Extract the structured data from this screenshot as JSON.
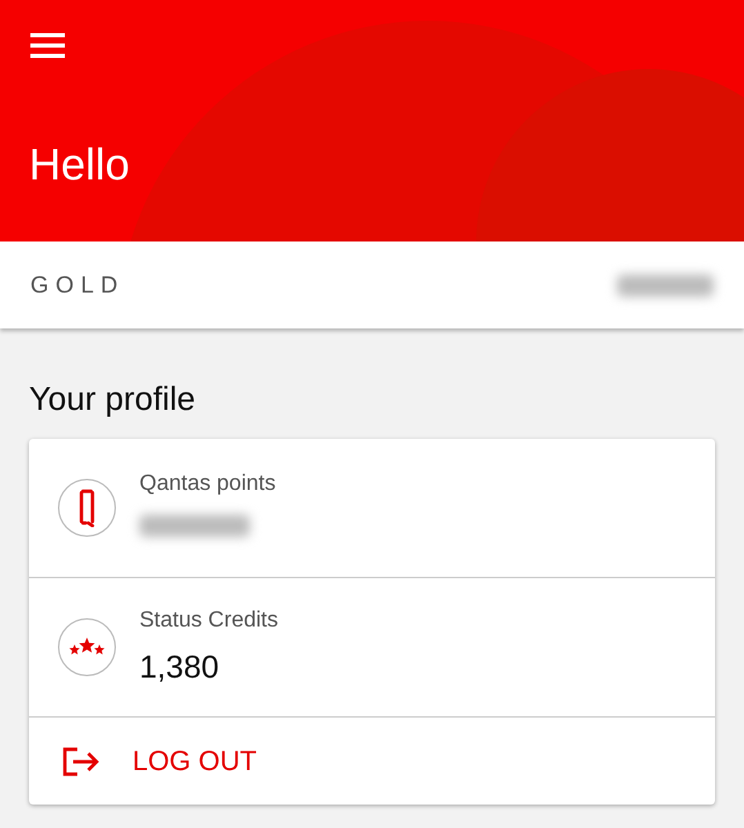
{
  "header": {
    "greeting": "Hello"
  },
  "membership": {
    "tier": "GOLD",
    "number_redacted": true
  },
  "profile": {
    "title": "Your profile",
    "items": [
      {
        "kind": "points",
        "label": "Qantas points",
        "value_redacted": true
      },
      {
        "kind": "credits",
        "label": "Status Credits",
        "value": "1,380",
        "value_redacted": false
      }
    ],
    "logout": "LOG OUT"
  }
}
